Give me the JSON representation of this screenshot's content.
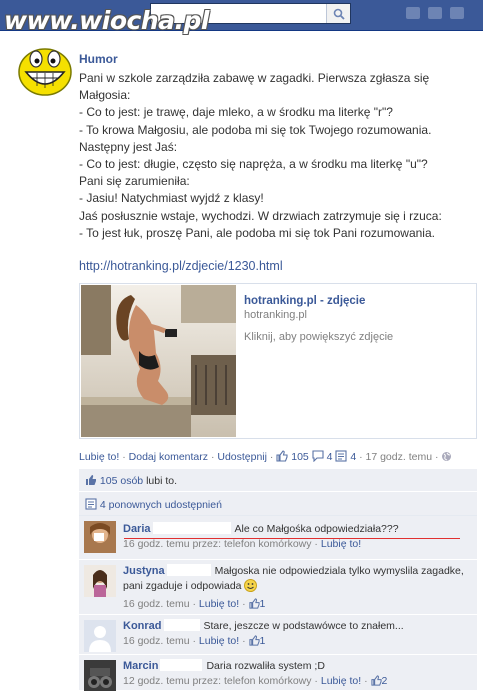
{
  "watermark": "www.wiocha.pl",
  "search": {
    "placeholder": ""
  },
  "post": {
    "author": "Humor",
    "lines": [
      "Pani w szkole zarządziła zabawę w zagadki. Pierwsza zgłasza się",
      "Małgosia:",
      "- Co to jest: je trawę, daje mleko, a w środku ma literkę \"r\"?",
      "- To krowa Małgosiu, ale podoba mi się tok Twojego rozumowania.",
      "Następny jest Jaś:",
      "- Co to jest: długie, często się napręża, a w środku ma literkę \"u\"?",
      "Pani się zarumieniła:",
      "- Jasiu! Natychmiast wyjdź z klasy!",
      "Jaś posłusznie wstaje, wychodzi. W drzwiach zatrzymuje się i rzuca:",
      "- To jest łuk, proszę Pani, ale podoba mi się tok Pani rozumowania."
    ],
    "link": "http://hotranking.pl/zdjecie/1230.html"
  },
  "attachment": {
    "title": "hotranking.pl - zdjęcie",
    "host": "hotranking.pl",
    "description": "Kliknij, aby powiększyć zdjęcie"
  },
  "actions": {
    "like": "Lubię to!",
    "comment": "Dodaj komentarz",
    "share": "Udostępnij",
    "like_count": "105",
    "comment_count": "4",
    "share_count": "4",
    "time": "17 godz. temu",
    "sep": "·"
  },
  "ufi": {
    "likes_link": "105 osób",
    "likes_suffix": "lubi to.",
    "shares_link": "4 ponownych udostępnień"
  },
  "comments": [
    {
      "name": "Daria",
      "text": "Ale co Małgośka odpowiedziała???",
      "time": "16 godz. temu przez: telefon komórkowy",
      "like": "Lubię to!",
      "likes": ""
    },
    {
      "name": "Justyna",
      "text": "Małgoska nie odpowiedziala tylko wymyslila zagadke, pani zgaduje i odpowiada",
      "time": "16 godz. temu",
      "like": "Lubię to!",
      "likes": "1"
    },
    {
      "name": "Konrad",
      "text": "Stare, jeszcze w podstawówce to znałem...",
      "time": "16 godz. temu",
      "like": "Lubię to!",
      "likes": "1"
    },
    {
      "name": "Marcin",
      "text": "Daria rozwaliła system ;D",
      "time": "12 godz. temu przez: telefon komórkowy",
      "like": "Lubię to!",
      "likes": "2"
    }
  ],
  "colors": {
    "fb_blue": "#3b5998",
    "link": "#3b5998",
    "ufi_bg": "#edeff4",
    "highlight": "#e03030"
  },
  "icons": [
    "search-icon",
    "like-thumb-icon",
    "comment-icon",
    "share-icon",
    "globe-icon",
    "smiley-icon"
  ]
}
